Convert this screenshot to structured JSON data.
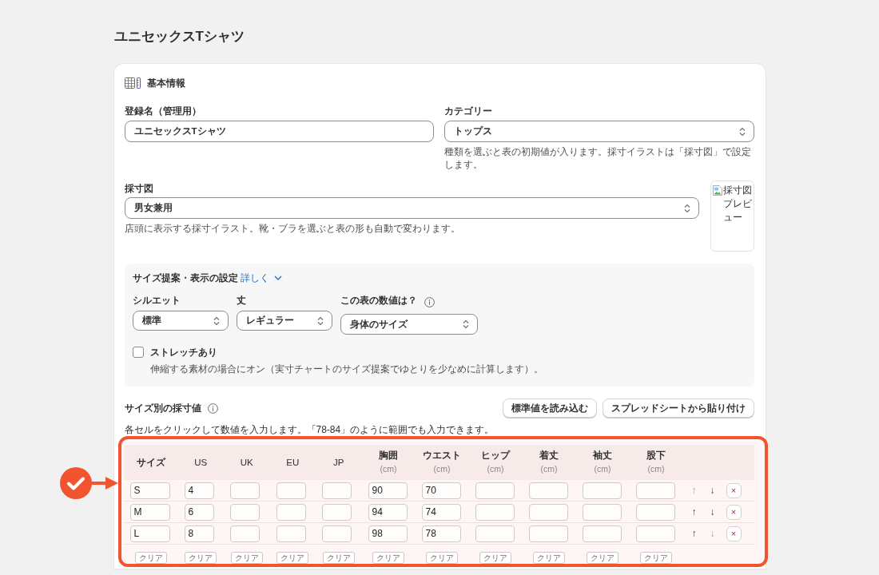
{
  "page_title": "ユニセックスTシャツ",
  "basic_info": {
    "heading": "基本情報",
    "name_field": {
      "label": "登録名（管理用）",
      "value": "ユニセックスTシャツ"
    },
    "category": {
      "label": "カテゴリー",
      "value": "トップス",
      "help": "種類を選ぶと表の初期値が入ります。採寸イラストは「採寸図」で設定します。"
    },
    "diagram": {
      "label": "採寸図",
      "value": "男女兼用",
      "help": "店頭に表示する採寸イラスト。靴・ブラを選ぶと表の形も自動で変わります。"
    },
    "preview": {
      "alt_text": "採寸図プレビュー"
    }
  },
  "size_settings": {
    "title": "サイズ提案・表示の設定",
    "link": "詳しく",
    "fields": [
      {
        "label": "シルエット",
        "value": "標準",
        "info": false
      },
      {
        "label": "丈",
        "value": "レギュラー",
        "info": false
      },
      {
        "label": "この表の数値は？",
        "value": "身体のサイズ",
        "info": true
      }
    ],
    "stretch": {
      "label": "ストレッチあり",
      "checked": false,
      "help": "伸縮する素材の場合にオン（実寸チャートのサイズ提案でゆとりを少なめに計算します）。"
    }
  },
  "measurements": {
    "title": "サイズ別の採寸値",
    "buttons": [
      "標準値を読み込む",
      "スプレッドシートから貼り付け"
    ],
    "help": "各セルをクリックして数値を入力します。「78-84」のように範囲でも入力できます。",
    "table": {
      "highlighted": true,
      "columns": [
        {
          "kind": "size",
          "label": "サイズ"
        },
        {
          "kind": "code",
          "label": "US"
        },
        {
          "kind": "code",
          "label": "UK"
        },
        {
          "kind": "code",
          "label": "EU"
        },
        {
          "kind": "code",
          "label": "JP"
        },
        {
          "kind": "measure",
          "label": "胸囲",
          "unit": "(cm)"
        },
        {
          "kind": "measure",
          "label": "ウエスト",
          "unit": "(cm)"
        },
        {
          "kind": "measure",
          "label": "ヒップ",
          "unit": "(cm)"
        },
        {
          "kind": "measure",
          "label": "着丈",
          "unit": "(cm)"
        },
        {
          "kind": "measure",
          "label": "袖丈",
          "unit": "(cm)"
        },
        {
          "kind": "measure",
          "label": "股下",
          "unit": "(cm)"
        }
      ],
      "rows": [
        {
          "cells": [
            "S",
            "4",
            null,
            null,
            null,
            "90",
            "70",
            null,
            null,
            null,
            null
          ],
          "actions": [
            {
              "kind": "up",
              "label": "↑",
              "disabled": true
            },
            {
              "kind": "down",
              "label": "↓",
              "disabled": false
            },
            {
              "kind": "delete",
              "label": "×"
            }
          ]
        },
        {
          "cells": [
            "M",
            "6",
            null,
            null,
            null,
            "94",
            "74",
            null,
            null,
            null,
            null
          ],
          "actions": [
            {
              "kind": "up",
              "label": "↑",
              "disabled": false
            },
            {
              "kind": "down",
              "label": "↓",
              "disabled": false
            },
            {
              "kind": "delete",
              "label": "×"
            }
          ]
        },
        {
          "cells": [
            "L",
            "8",
            null,
            null,
            null,
            "98",
            "78",
            null,
            null,
            null,
            null
          ],
          "actions": [
            {
              "kind": "up",
              "label": "↑",
              "disabled": false
            },
            {
              "kind": "down",
              "label": "↓",
              "disabled": true
            },
            {
              "kind": "delete",
              "label": "×"
            }
          ]
        }
      ],
      "clear_buttons": [
        "クリア",
        "クリア",
        "クリア",
        "クリア",
        "クリア",
        "クリア",
        "クリア",
        "クリア",
        "クリア",
        "クリア",
        "クリア"
      ]
    }
  }
}
